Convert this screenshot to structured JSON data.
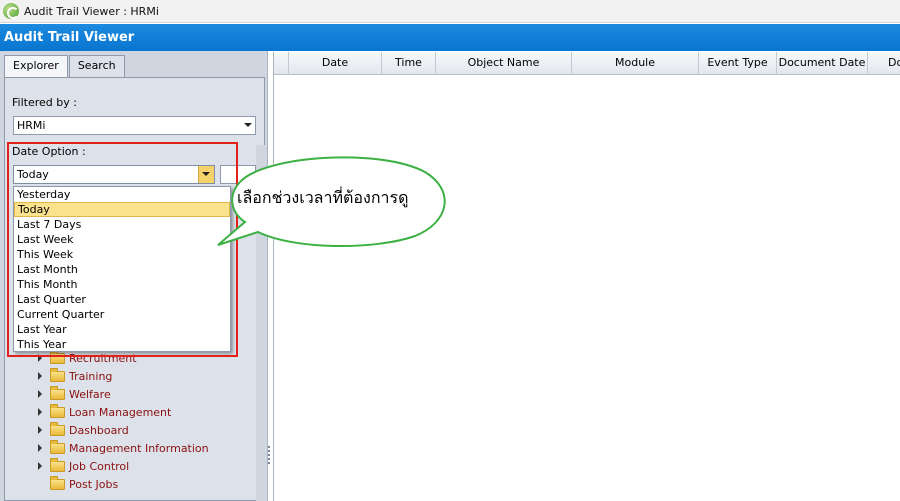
{
  "window": {
    "title": "Audit Trail Viewer : HRMi",
    "icon": "app-refresh-icon"
  },
  "header": {
    "title": "Audit Trail Viewer"
  },
  "tabs": [
    {
      "label": "Explorer",
      "active": true
    },
    {
      "label": "Search",
      "active": false
    }
  ],
  "filter": {
    "label": "Filtered by :",
    "value": "HRMi"
  },
  "date_option": {
    "label": "Date Option :",
    "value": "Today",
    "options": [
      "Yesterday",
      "Today",
      "Last 7 Days",
      "Last Week",
      "This Week",
      "Last Month",
      "This Month",
      "Last Quarter",
      "Current Quarter",
      "Last Year",
      "This Year"
    ],
    "selected_index": 1
  },
  "tree": [
    {
      "label": "Recruitment",
      "expandable": true
    },
    {
      "label": "Training",
      "expandable": true
    },
    {
      "label": "Welfare",
      "expandable": true
    },
    {
      "label": "Loan Management",
      "expandable": true
    },
    {
      "label": "Dashboard",
      "expandable": true
    },
    {
      "label": "Management Information",
      "expandable": true
    },
    {
      "label": "Job Control",
      "expandable": true
    },
    {
      "label": "Post Jobs",
      "expandable": false
    }
  ],
  "grid": {
    "columns": [
      "",
      "Date",
      "Time",
      "Object Name",
      "Module",
      "Event Type",
      "Document Date",
      "Docu"
    ]
  },
  "callout": {
    "text": "เลือกช่วงเวลาที่ต้องการดู"
  },
  "colors": {
    "header_blue": "#0b79d3",
    "highlight_red": "#e0221b",
    "selected_item": "#fbe38e",
    "tree_text": "#8a1010",
    "callout_border": "#3cb043"
  }
}
